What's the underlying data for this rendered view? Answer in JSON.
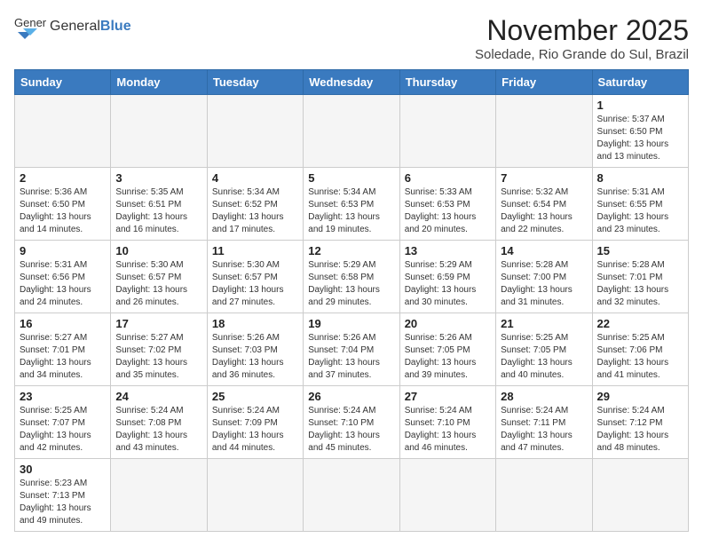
{
  "header": {
    "logo_text_normal": "General",
    "logo_text_bold": "Blue",
    "month_title": "November 2025",
    "location": "Soledade, Rio Grande do Sul, Brazil"
  },
  "days_of_week": [
    "Sunday",
    "Monday",
    "Tuesday",
    "Wednesday",
    "Thursday",
    "Friday",
    "Saturday"
  ],
  "weeks": [
    [
      {
        "day": "",
        "info": ""
      },
      {
        "day": "",
        "info": ""
      },
      {
        "day": "",
        "info": ""
      },
      {
        "day": "",
        "info": ""
      },
      {
        "day": "",
        "info": ""
      },
      {
        "day": "",
        "info": ""
      },
      {
        "day": "1",
        "info": "Sunrise: 5:37 AM\nSunset: 6:50 PM\nDaylight: 13 hours and 13 minutes."
      }
    ],
    [
      {
        "day": "2",
        "info": "Sunrise: 5:36 AM\nSunset: 6:50 PM\nDaylight: 13 hours and 14 minutes."
      },
      {
        "day": "3",
        "info": "Sunrise: 5:35 AM\nSunset: 6:51 PM\nDaylight: 13 hours and 16 minutes."
      },
      {
        "day": "4",
        "info": "Sunrise: 5:34 AM\nSunset: 6:52 PM\nDaylight: 13 hours and 17 minutes."
      },
      {
        "day": "5",
        "info": "Sunrise: 5:34 AM\nSunset: 6:53 PM\nDaylight: 13 hours and 19 minutes."
      },
      {
        "day": "6",
        "info": "Sunrise: 5:33 AM\nSunset: 6:53 PM\nDaylight: 13 hours and 20 minutes."
      },
      {
        "day": "7",
        "info": "Sunrise: 5:32 AM\nSunset: 6:54 PM\nDaylight: 13 hours and 22 minutes."
      },
      {
        "day": "8",
        "info": "Sunrise: 5:31 AM\nSunset: 6:55 PM\nDaylight: 13 hours and 23 minutes."
      }
    ],
    [
      {
        "day": "9",
        "info": "Sunrise: 5:31 AM\nSunset: 6:56 PM\nDaylight: 13 hours and 24 minutes."
      },
      {
        "day": "10",
        "info": "Sunrise: 5:30 AM\nSunset: 6:57 PM\nDaylight: 13 hours and 26 minutes."
      },
      {
        "day": "11",
        "info": "Sunrise: 5:30 AM\nSunset: 6:57 PM\nDaylight: 13 hours and 27 minutes."
      },
      {
        "day": "12",
        "info": "Sunrise: 5:29 AM\nSunset: 6:58 PM\nDaylight: 13 hours and 29 minutes."
      },
      {
        "day": "13",
        "info": "Sunrise: 5:29 AM\nSunset: 6:59 PM\nDaylight: 13 hours and 30 minutes."
      },
      {
        "day": "14",
        "info": "Sunrise: 5:28 AM\nSunset: 7:00 PM\nDaylight: 13 hours and 31 minutes."
      },
      {
        "day": "15",
        "info": "Sunrise: 5:28 AM\nSunset: 7:01 PM\nDaylight: 13 hours and 32 minutes."
      }
    ],
    [
      {
        "day": "16",
        "info": "Sunrise: 5:27 AM\nSunset: 7:01 PM\nDaylight: 13 hours and 34 minutes."
      },
      {
        "day": "17",
        "info": "Sunrise: 5:27 AM\nSunset: 7:02 PM\nDaylight: 13 hours and 35 minutes."
      },
      {
        "day": "18",
        "info": "Sunrise: 5:26 AM\nSunset: 7:03 PM\nDaylight: 13 hours and 36 minutes."
      },
      {
        "day": "19",
        "info": "Sunrise: 5:26 AM\nSunset: 7:04 PM\nDaylight: 13 hours and 37 minutes."
      },
      {
        "day": "20",
        "info": "Sunrise: 5:26 AM\nSunset: 7:05 PM\nDaylight: 13 hours and 39 minutes."
      },
      {
        "day": "21",
        "info": "Sunrise: 5:25 AM\nSunset: 7:05 PM\nDaylight: 13 hours and 40 minutes."
      },
      {
        "day": "22",
        "info": "Sunrise: 5:25 AM\nSunset: 7:06 PM\nDaylight: 13 hours and 41 minutes."
      }
    ],
    [
      {
        "day": "23",
        "info": "Sunrise: 5:25 AM\nSunset: 7:07 PM\nDaylight: 13 hours and 42 minutes."
      },
      {
        "day": "24",
        "info": "Sunrise: 5:24 AM\nSunset: 7:08 PM\nDaylight: 13 hours and 43 minutes."
      },
      {
        "day": "25",
        "info": "Sunrise: 5:24 AM\nSunset: 7:09 PM\nDaylight: 13 hours and 44 minutes."
      },
      {
        "day": "26",
        "info": "Sunrise: 5:24 AM\nSunset: 7:10 PM\nDaylight: 13 hours and 45 minutes."
      },
      {
        "day": "27",
        "info": "Sunrise: 5:24 AM\nSunset: 7:10 PM\nDaylight: 13 hours and 46 minutes."
      },
      {
        "day": "28",
        "info": "Sunrise: 5:24 AM\nSunset: 7:11 PM\nDaylight: 13 hours and 47 minutes."
      },
      {
        "day": "29",
        "info": "Sunrise: 5:24 AM\nSunset: 7:12 PM\nDaylight: 13 hours and 48 minutes."
      }
    ],
    [
      {
        "day": "30",
        "info": "Sunrise: 5:23 AM\nSunset: 7:13 PM\nDaylight: 13 hours and 49 minutes."
      },
      {
        "day": "",
        "info": ""
      },
      {
        "day": "",
        "info": ""
      },
      {
        "day": "",
        "info": ""
      },
      {
        "day": "",
        "info": ""
      },
      {
        "day": "",
        "info": ""
      },
      {
        "day": "",
        "info": ""
      }
    ]
  ]
}
